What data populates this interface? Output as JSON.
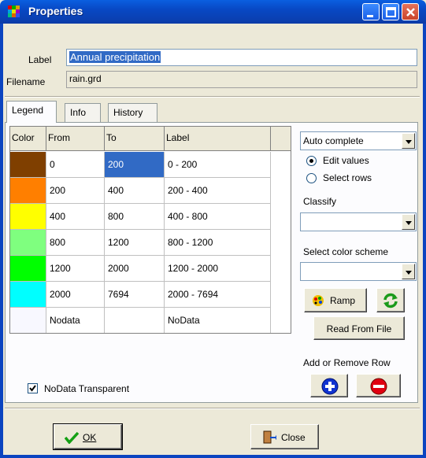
{
  "window": {
    "title": "Properties"
  },
  "fields": {
    "label_caption": "Label",
    "label_value": "Annual precipitation",
    "filename_caption": "Filename",
    "filename_value": "rain.grd"
  },
  "tabs": [
    {
      "label": "Legend",
      "active": true
    },
    {
      "label": "Info",
      "active": false
    },
    {
      "label": "History",
      "active": false
    }
  ],
  "grid": {
    "headers": [
      "Color",
      "From",
      "To",
      "Label"
    ],
    "rows": [
      {
        "color": "#7f3f00",
        "from": "0",
        "to": "200",
        "label": "0 - 200"
      },
      {
        "color": "#ff7f00",
        "from": "200",
        "to": "400",
        "label": "200 - 400"
      },
      {
        "color": "#ffff00",
        "from": "400",
        "to": "800",
        "label": "400 - 800"
      },
      {
        "color": "#7fff7f",
        "from": "800",
        "to": "1200",
        "label": "800 - 1200"
      },
      {
        "color": "#00ff00",
        "from": "1200",
        "to": "2000",
        "label": "1200 - 2000"
      },
      {
        "color": "#00ffff",
        "from": "2000",
        "to": "7694",
        "label": "2000 - 7694"
      },
      {
        "color": "#f8f8ff",
        "from": "Nodata",
        "to": "",
        "label": "NoData"
      }
    ]
  },
  "right_panel": {
    "mode_select": "Auto complete",
    "radio_edit": "Edit values",
    "radio_select": "Select rows",
    "classify_caption": "Classify",
    "classify_value": "",
    "scheme_caption": "Select color scheme",
    "scheme_value": "",
    "ramp_label": "Ramp",
    "read_file_label": "Read From File",
    "add_remove_caption": "Add or Remove Row"
  },
  "nodata_transparent": {
    "label": "NoData Transparent",
    "checked": true
  },
  "buttons": {
    "ok": "OK",
    "close": "Close"
  }
}
